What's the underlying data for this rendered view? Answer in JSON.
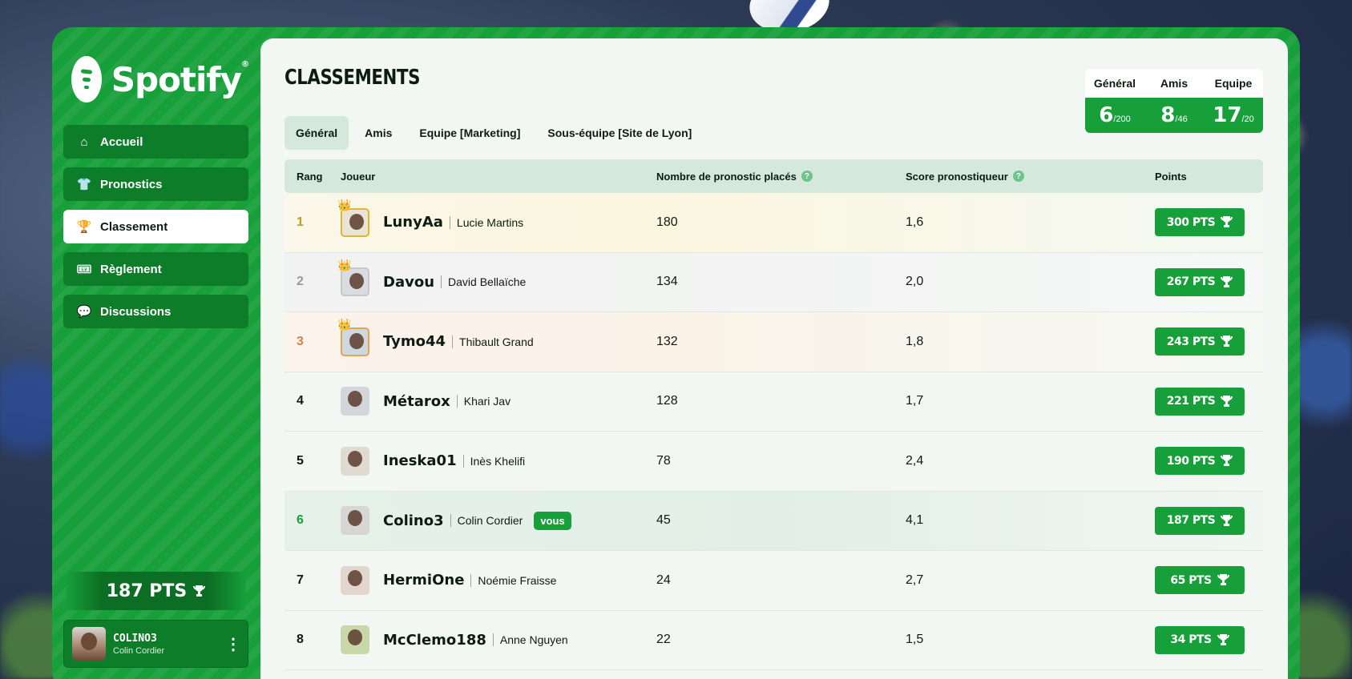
{
  "brand": {
    "name": "Spotify",
    "reg": "®"
  },
  "nav": [
    {
      "label": "Accueil",
      "icon": "home-icon",
      "glyph": "⌂",
      "active": false
    },
    {
      "label": "Pronostics",
      "icon": "jersey-icon",
      "glyph": "👕",
      "active": false
    },
    {
      "label": "Classement",
      "icon": "trophy-icon",
      "glyph": "🏆",
      "active": true
    },
    {
      "label": "Règlement",
      "icon": "tickets-icon",
      "glyph": "🎟",
      "active": false
    },
    {
      "label": "Discussions",
      "icon": "chat-icon",
      "glyph": "💬",
      "active": false
    }
  ],
  "sidebar_points": "187 PTS",
  "user": {
    "handle": "COLINO3",
    "name": "Colin Cordier"
  },
  "page": {
    "title": "CLASSEMENTS"
  },
  "tabs": [
    {
      "label": "Général",
      "active": true
    },
    {
      "label": "Amis",
      "active": false
    },
    {
      "label": "Equipe [Marketing]",
      "active": false
    },
    {
      "label": "Sous-équipe [Site de Lyon]",
      "active": false
    }
  ],
  "ranks": [
    {
      "label": "Général",
      "value": "6",
      "total": "/200"
    },
    {
      "label": "Amis",
      "value": "8",
      "total": "/46"
    },
    {
      "label": "Equipe",
      "value": "17",
      "total": "/20"
    }
  ],
  "table": {
    "headers": {
      "rank": "Rang",
      "player": "Joueur",
      "count": "Nombre de pronostic placés",
      "score": "Score pronostiqueur",
      "points": "Points"
    },
    "help_glyph": "?",
    "you_badge": "vous",
    "rows": [
      {
        "rank": "1",
        "handle": "LunyAa",
        "name": "Lucie Martins",
        "count": "180",
        "score": "1,6",
        "points": "300 PTS",
        "medal": "gold"
      },
      {
        "rank": "2",
        "handle": "Davou",
        "name": "David Bellaïche",
        "count": "134",
        "score": "2,0",
        "points": "267 PTS",
        "medal": "silver"
      },
      {
        "rank": "3",
        "handle": "Tymo44",
        "name": "Thibault Grand",
        "count": "132",
        "score": "1,8",
        "points": "243 PTS",
        "medal": "bronze"
      },
      {
        "rank": "4",
        "handle": "Métarox",
        "name": "Khari Jav",
        "count": "128",
        "score": "1,7",
        "points": "221 PTS",
        "medal": ""
      },
      {
        "rank": "5",
        "handle": "Ineska01",
        "name": "Inès Khelifi",
        "count": "78",
        "score": "2,4",
        "points": "190 PTS",
        "medal": ""
      },
      {
        "rank": "6",
        "handle": "Colino3",
        "name": "Colin Cordier",
        "count": "45",
        "score": "4,1",
        "points": "187 PTS",
        "medal": "",
        "me": true
      },
      {
        "rank": "7",
        "handle": "HermiOne",
        "name": "Noémie Fraisse",
        "count": "24",
        "score": "2,7",
        "points": "65 PTS",
        "medal": ""
      },
      {
        "rank": "8",
        "handle": "McClemo188",
        "name": "Anne Nguyen",
        "count": "22",
        "score": "1,5",
        "points": "34 PTS",
        "medal": ""
      }
    ]
  },
  "colors": {
    "brand_green": "#179f3a",
    "dark_green": "#0e7d2a",
    "rank_gold": "#b8a21e",
    "rank_silver": "#9a9a9a",
    "rank_bronze": "#d2834a",
    "rank_me": "#179f3a"
  }
}
